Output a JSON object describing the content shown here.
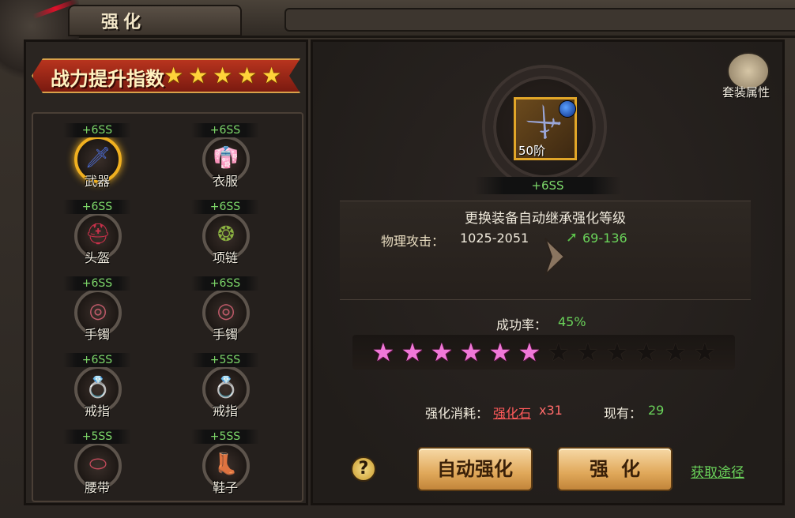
{
  "title": "强化",
  "power": {
    "label": "战力提升指数",
    "stars": 5
  },
  "equipment": [
    {
      "name": "武器",
      "level": "+6SS",
      "icon": "spear-icon",
      "color": "#4a6ad0",
      "selected": true
    },
    {
      "name": "衣服",
      "level": "+6SS",
      "icon": "robe-icon",
      "color": "#b04ab8",
      "selected": false
    },
    {
      "name": "头盔",
      "level": "+6SS",
      "icon": "helmet-icon",
      "color": "#c8304a",
      "selected": false
    },
    {
      "name": "项链",
      "level": "+6SS",
      "icon": "necklace-icon",
      "color": "#8ab040",
      "selected": false
    },
    {
      "name": "手镯",
      "level": "+6SS",
      "icon": "bracelet-icon",
      "color": "#c05a6a",
      "selected": false
    },
    {
      "name": "手镯",
      "level": "+6SS",
      "icon": "bracelet-icon",
      "color": "#c05a6a",
      "selected": false
    },
    {
      "name": "戒指",
      "level": "+6SS",
      "icon": "ring-icon",
      "color": "#3a7ae0",
      "selected": false
    },
    {
      "name": "戒指",
      "level": "+5SS",
      "icon": "ring-icon",
      "color": "#3a8ae0",
      "selected": false
    },
    {
      "name": "腰带",
      "level": "+5SS",
      "icon": "belt-icon",
      "color": "#c04a5a",
      "selected": false
    },
    {
      "name": "鞋子",
      "level": "+5SS",
      "icon": "boots-icon",
      "color": "#d04060",
      "selected": false
    }
  ],
  "selected_item": {
    "stage": "50阶",
    "level": "+6SS"
  },
  "notice": "更换装备自动继承强化等级",
  "attribute": {
    "label": "物理攻击：",
    "current": "1025-2051",
    "next": "69-136"
  },
  "success": {
    "label": "成功率：",
    "value": "45%",
    "stars_on": 6,
    "stars_total": 12
  },
  "cost": {
    "label": "强化消耗：",
    "item": "强化石",
    "count": "x31",
    "owned_label": "现有：",
    "owned": "29"
  },
  "buttons": {
    "auto": "自动强化",
    "enhance": "强化",
    "acquire": "获取途径",
    "help": "?"
  },
  "suit": {
    "label": "套装属性"
  }
}
